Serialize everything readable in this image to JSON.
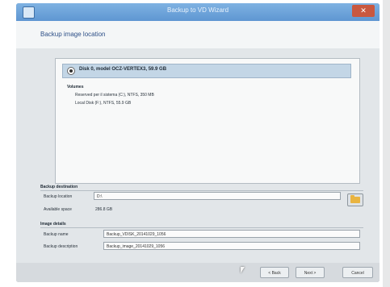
{
  "window": {
    "title": "Backup to VD Wizard",
    "close_glyph": "✕"
  },
  "page": {
    "title": "Backup image location"
  },
  "disk": {
    "label": "Disk 0, model OCZ-VERTEX3, 59.9 GB",
    "volumes_heading": "Volumes",
    "volumes": [
      "Reserved per il sistema (C:), NTFS, 350 MB",
      "Local Disk (F:), NTFS, 55.9 GB"
    ]
  },
  "destination": {
    "group_label": "Backup destination",
    "location_label": "Backup location",
    "location_value": "D:\\",
    "space_label": "Available space",
    "space_value": "286.8 GB"
  },
  "image_details": {
    "group_label": "Image details",
    "name_label": "Backup name",
    "name_value": "Backup_VDISK_20141029_1056",
    "description_label": "Backup description",
    "description_value": "Backup_image_20141029_1056"
  },
  "buttons": {
    "back": "< Back",
    "next": "Next >",
    "cancel": "Cancel"
  },
  "icons": [
    "app-icon",
    "close-icon",
    "radio-selected-icon",
    "folder-icon",
    "mouse-cursor-icon"
  ]
}
